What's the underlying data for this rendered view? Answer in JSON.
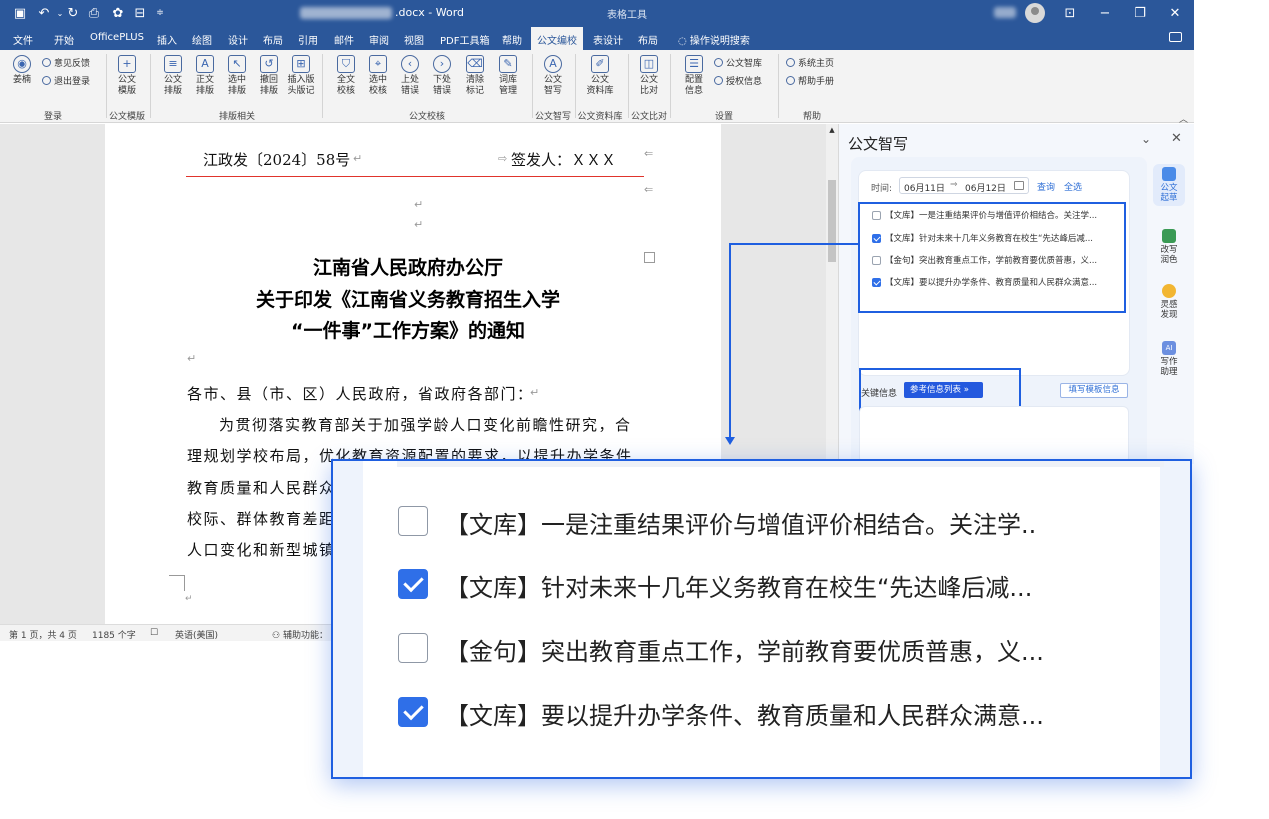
{
  "titlebar": {
    "doc_suffix": ".docx - Word",
    "context_tab_label": "表格工具"
  },
  "tabs": [
    "文件",
    "开始",
    "OfficePLUS",
    "插入",
    "绘图",
    "设计",
    "布局",
    "引用",
    "邮件",
    "审阅",
    "视图",
    "PDF工具箱",
    "帮助",
    "公文编校",
    "表设计",
    "布局"
  ],
  "tell_me": "操作说明搜索",
  "ribbon": {
    "login": {
      "user": "姜楠",
      "feedback": "意见反馈",
      "logout": "退出登录",
      "group": "登录"
    },
    "template": {
      "btn": "公文\n模版",
      "group": "公文模版"
    },
    "layout": {
      "buttons": [
        "公文\n排版",
        "正文\n排版",
        "选中\n排版",
        "撤回\n排版",
        "插入版\n头版记"
      ],
      "group": "排版相关"
    },
    "proof": {
      "buttons": [
        "全文\n校核",
        "选中\n校核",
        "上处\n错误",
        "下处\n错误",
        "清除\n标记",
        "词库\n管理"
      ],
      "group": "公文校核"
    },
    "smart": {
      "btn": "公文\n智写",
      "group": "公文智写"
    },
    "library": {
      "btn": "公文\n资料库",
      "group": "公文资料库"
    },
    "compare": {
      "btn": "公文\n比对",
      "group": "公文比对"
    },
    "settings": {
      "btn": "配置\n信息",
      "lib": "公文智库",
      "auth": "授权信息",
      "group": "设置"
    },
    "help": {
      "home": "系统主页",
      "manual": "帮助手册",
      "group": "帮助"
    }
  },
  "document": {
    "doc_no": "江政发〔2024〕58号",
    "signer": "签发人：ＸＸＸ",
    "heading": [
      "江南省人民政府办公厅",
      "关于印发《江南省义务教育招生入学",
      "“一件事”工作方案》的通知"
    ],
    "recipients": "各市、县（市、区）人民政府，省政府各部门：",
    "body": [
      "为贯彻落实教育部关于加强学龄人口变化前瞻性研究，合",
      "理规划学校布局，优化教育资源配置的要求，以提升办学条件",
      "教育质量和人民群众",
      "校际、群体教育差距",
      "人口变化和新型城镇"
    ]
  },
  "statusbar": {
    "page": "第 1 页，共 4 页",
    "words": "1185 个字",
    "lang": "英语(美国)",
    "accessibility": "辅助功能："
  },
  "pane": {
    "title": "公文智写",
    "time_label": "时间:",
    "date_start": "06月11日",
    "date_end": "06月12日",
    "query": "查询",
    "select_all": "全选",
    "items": [
      {
        "text": "【文库】一是注重结果评价与增值评价相结合。关注学...",
        "checked": false
      },
      {
        "text": "【文库】针对未来十几年义务教育在校生“先达峰后减...",
        "checked": true
      },
      {
        "text": "【金句】突出教育重点工作，学前教育要优质普惠，义...",
        "checked": false
      },
      {
        "text": "【文库】要以提升办学条件、教育质量和人民群众满意...",
        "checked": true
      }
    ],
    "keyword_label": "关键信息",
    "ref_button": "参考信息列表",
    "template_button": "填写模板信息",
    "rail": [
      "公文\n起草",
      "改写\n润色",
      "灵感\n发现",
      "写作\n助理"
    ]
  },
  "zoom_items": [
    {
      "text": "【文库】一是注重结果评价与增值评价相结合。关注学..",
      "checked": false
    },
    {
      "text": "【文库】针对未来十几年义务教育在校生“先达峰后减...",
      "checked": true
    },
    {
      "text": "【金句】突出教育重点工作，学前教育要优质普惠，义...",
      "checked": false
    },
    {
      "text": "【文库】要以提升办学条件、教育质量和人民群众满意...",
      "checked": true
    }
  ],
  "colors": {
    "word_blue": "#2b579a",
    "accent": "#1f5fe0",
    "check": "#2f6fe8",
    "rule_red": "#e0342c"
  }
}
